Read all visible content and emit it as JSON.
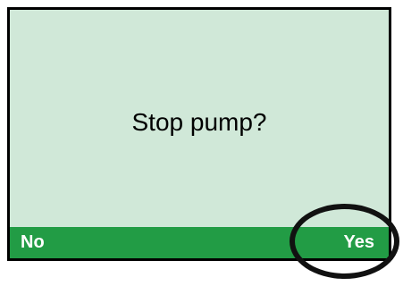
{
  "dialog": {
    "prompt": "Stop pump?"
  },
  "softkeys": {
    "left_label": "No",
    "right_label": "Yes"
  },
  "colors": {
    "screen_background": "#d0e8d8",
    "softkey_bar": "#229c45",
    "softkey_text": "#ffffff",
    "border": "#000000"
  }
}
